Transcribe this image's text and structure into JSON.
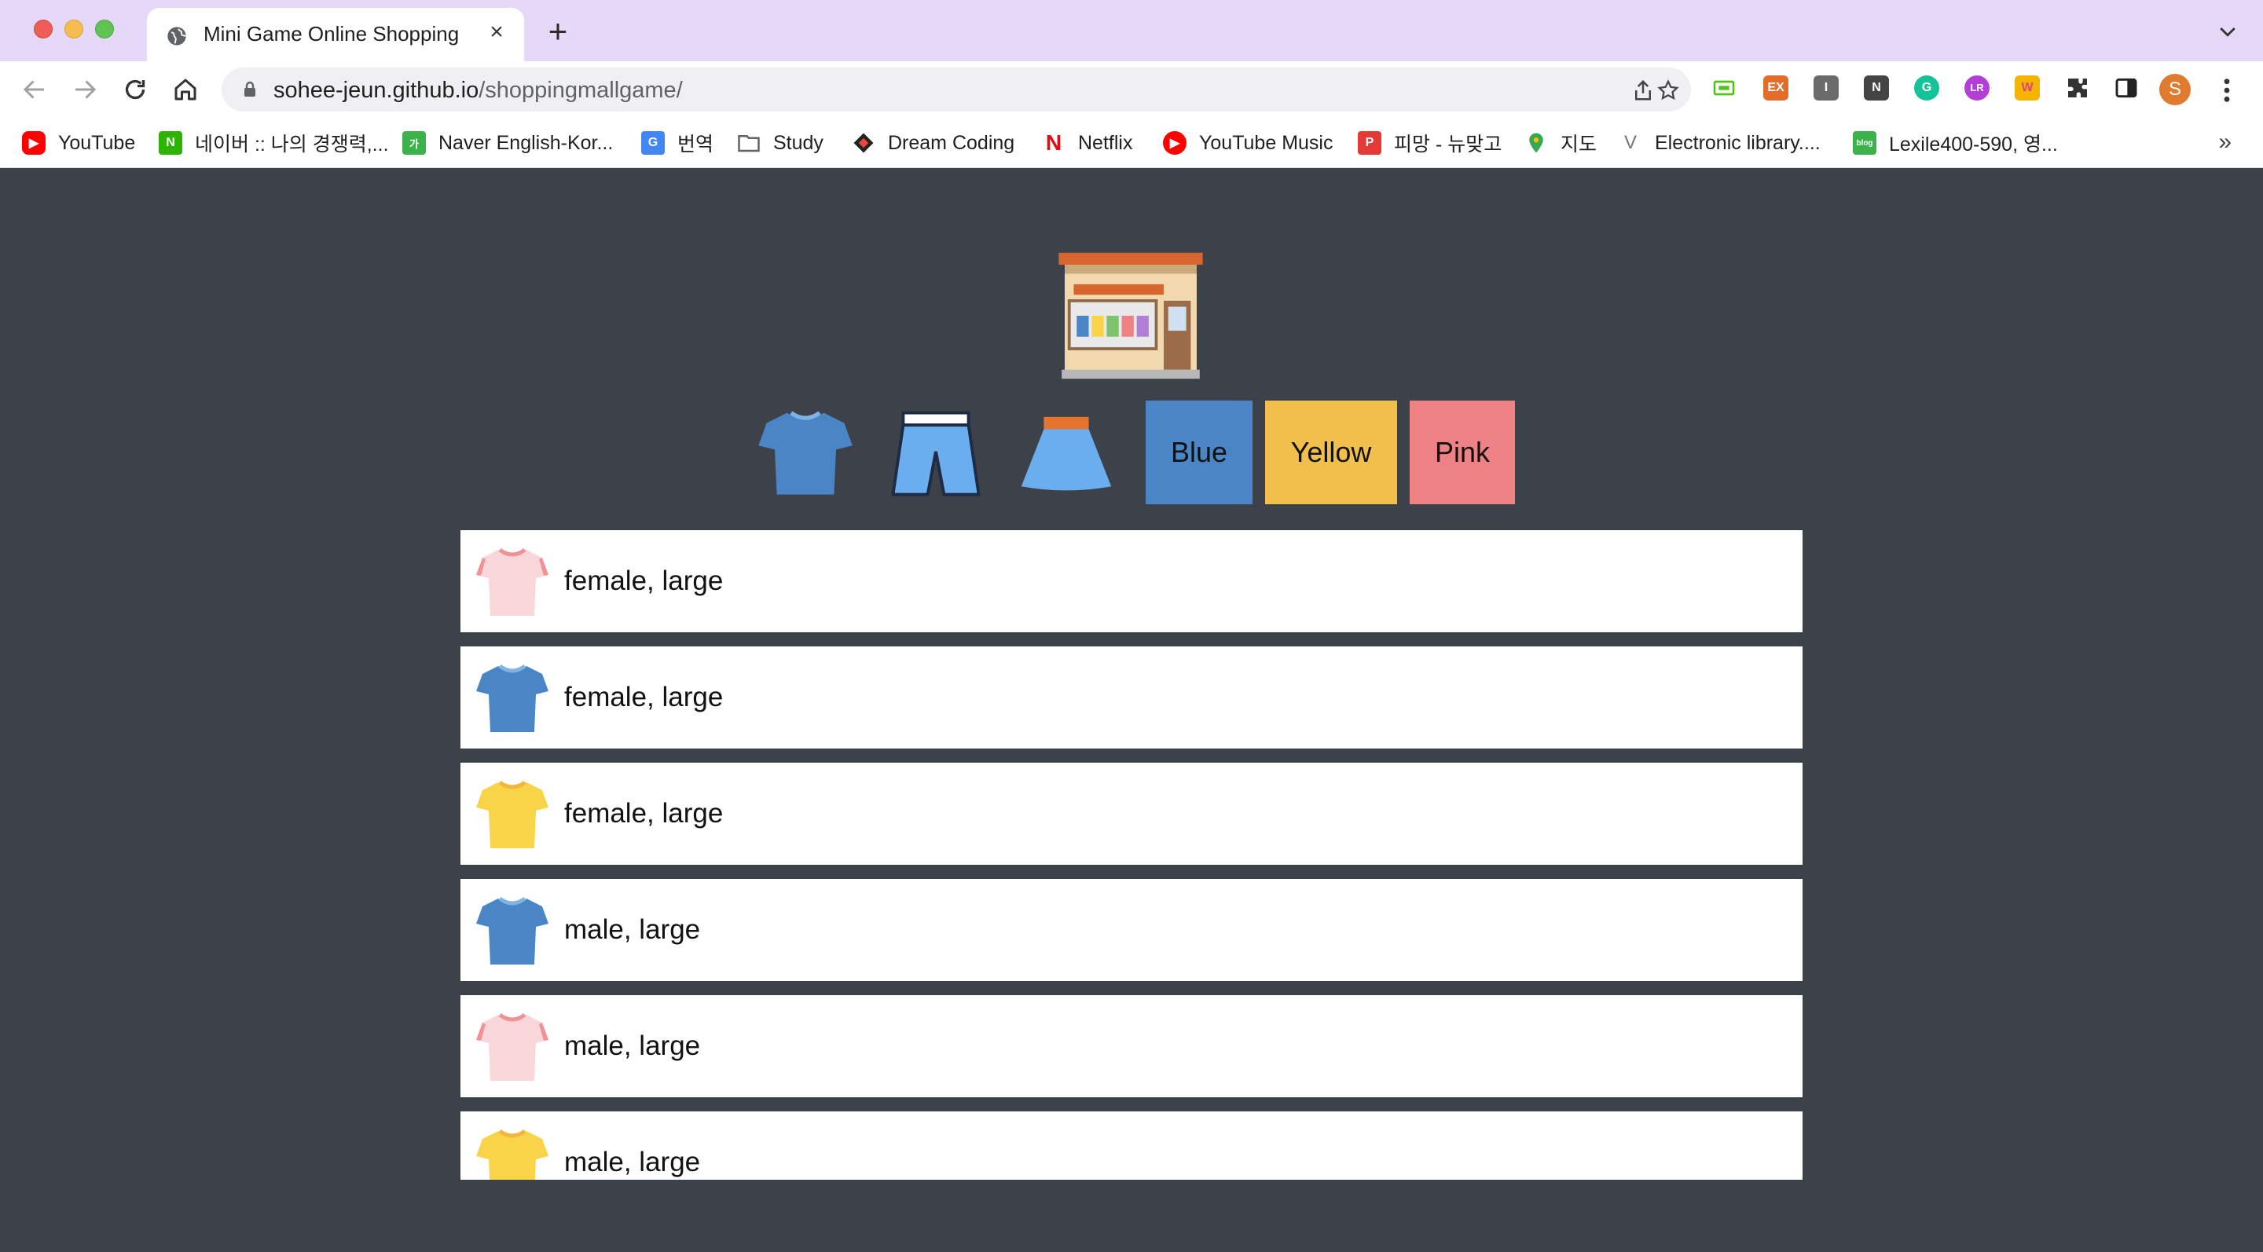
{
  "browser": {
    "tab": {
      "title": "Mini Game Online Shopping"
    },
    "url": {
      "host": "sohee-jeun.github.io",
      "path": "/shoppingmallgame/"
    },
    "profile_initial": "S",
    "bookmarks": [
      {
        "label": "YouTube",
        "icon": "youtube-icon",
        "color": "#ff0000"
      },
      {
        "label": "네이버 :: 나의 경쟁력,...",
        "icon": "naver-icon",
        "color": "#2db400"
      },
      {
        "label": "Naver English-Kor...",
        "icon": "naver-dictionary-icon",
        "color": "#3cb34a"
      },
      {
        "label": "번역",
        "icon": "google-translate-icon",
        "color": "#4285f4"
      },
      {
        "label": "Study",
        "icon": "folder-icon",
        "color": "#5f6368"
      },
      {
        "label": "Dream Coding",
        "icon": "dream-coding-icon",
        "color": "#e8473c"
      },
      {
        "label": "Netflix",
        "icon": "netflix-icon",
        "color": "#e50914"
      },
      {
        "label": "YouTube Music",
        "icon": "youtube-music-icon",
        "color": "#ff0000"
      },
      {
        "label": "피망 - 뉴맞고",
        "icon": "pmang-icon",
        "color": "#e53935"
      },
      {
        "label": "지도",
        "icon": "google-maps-icon",
        "color": "#34a853"
      },
      {
        "label": "Electronic library....",
        "icon": "electronic-library-icon",
        "color": "#777777"
      },
      {
        "label": "Lexile400-590, 영...",
        "icon": "blog-icon",
        "color": "#3cb34a"
      }
    ],
    "extensions": [
      {
        "label": "",
        "icon": "screen-extension-icon",
        "color": "#52c41a"
      },
      {
        "label": "EX",
        "icon": "ex-extension-icon",
        "color": "#e56d2b"
      },
      {
        "label": "I",
        "icon": "i-extension-icon",
        "color": "#6b6b6b"
      },
      {
        "label": "N",
        "icon": "n-extension-icon",
        "color": "#444444"
      },
      {
        "label": "G",
        "icon": "grammarly-icon",
        "color": "#15c39a"
      },
      {
        "label": "LR",
        "icon": "lr-extension-icon",
        "color": "#b23fd6"
      },
      {
        "label": "W",
        "icon": "w-extension-icon",
        "color": "#f5b400"
      }
    ]
  },
  "game": {
    "filters": {
      "colors": [
        {
          "label": "Blue",
          "color": "#4a86c5"
        },
        {
          "label": "Yellow",
          "color": "#f2bf4c"
        },
        {
          "label": "Pink",
          "color": "#ee8184"
        }
      ]
    },
    "items": [
      {
        "type": "tshirt",
        "color": "pink",
        "text": "female, large"
      },
      {
        "type": "tshirt",
        "color": "blue",
        "text": "female, large"
      },
      {
        "type": "tshirt",
        "color": "yellow",
        "text": "female, large"
      },
      {
        "type": "tshirt",
        "color": "blue",
        "text": "male, large"
      },
      {
        "type": "tshirt",
        "color": "pink",
        "text": "male, large"
      },
      {
        "type": "tshirt",
        "color": "yellow",
        "text": "male, large"
      }
    ],
    "palette": {
      "blue": "#4a86c5",
      "pink": "#f9d6da",
      "yellow": "#f9d448",
      "page_bg": "#3d424a"
    }
  }
}
